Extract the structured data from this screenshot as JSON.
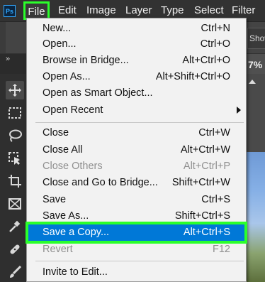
{
  "app": {
    "logo_text": "Ps"
  },
  "menubar": {
    "file": "File",
    "edit": "Edit",
    "image": "Image",
    "layer": "Layer",
    "type": "Type",
    "select": "Select",
    "filter": "Filter"
  },
  "optionsbar": {
    "show_label": "Show"
  },
  "tabbar": {
    "collapse_glyph": "»",
    "zoom_fragment": "7%"
  },
  "file_menu": {
    "items": [
      {
        "label": "New...",
        "shortcut": "Ctrl+N"
      },
      {
        "label": "Open...",
        "shortcut": "Ctrl+O"
      },
      {
        "label": "Browse in Bridge...",
        "shortcut": "Alt+Ctrl+O"
      },
      {
        "label": "Open As...",
        "shortcut": "Alt+Shift+Ctrl+O"
      },
      {
        "label": "Open as Smart Object...",
        "shortcut": ""
      },
      {
        "label": "Open Recent",
        "shortcut": ""
      },
      {
        "label": "Close",
        "shortcut": "Ctrl+W"
      },
      {
        "label": "Close All",
        "shortcut": "Alt+Ctrl+W"
      },
      {
        "label": "Close Others",
        "shortcut": "Alt+Ctrl+P"
      },
      {
        "label": "Close and Go to Bridge...",
        "shortcut": "Shift+Ctrl+W"
      },
      {
        "label": "Save",
        "shortcut": "Ctrl+S"
      },
      {
        "label": "Save As...",
        "shortcut": "Shift+Ctrl+S"
      },
      {
        "label": "Save a Copy...",
        "shortcut": "Alt+Ctrl+S"
      },
      {
        "label": "Revert",
        "shortcut": "F12"
      },
      {
        "label": "Invite to Edit...",
        "shortcut": ""
      }
    ]
  },
  "toolbar": {
    "tools": [
      "move-tool",
      "marquee-tool",
      "lasso-tool",
      "object-selection-tool",
      "crop-tool",
      "frame-tool",
      "eyedropper-tool",
      "healing-brush-tool",
      "brush-tool"
    ]
  },
  "colors": {
    "highlight": "#0078d7",
    "annotation": "#2bff2b",
    "menu_bg": "#f2f2f2",
    "chrome_bg": "#323232"
  }
}
